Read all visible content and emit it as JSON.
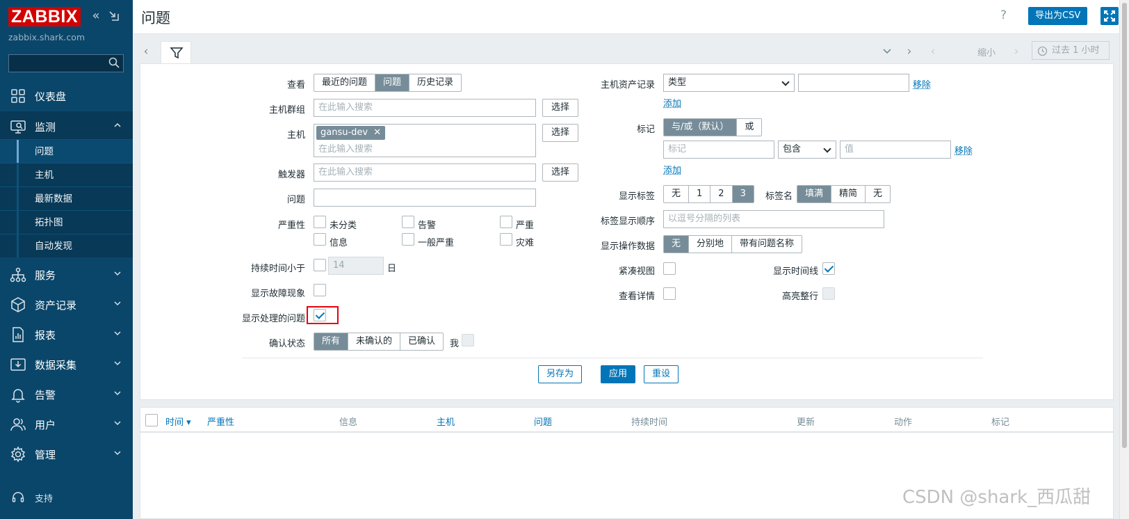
{
  "brand": {
    "logo": "ZABBIX",
    "server": "zabbix.shark.com"
  },
  "sidebar": {
    "nav": [
      {
        "label": "仪表盘",
        "icon": "dashboard-icon"
      },
      {
        "label": "监测",
        "icon": "monitoring-icon",
        "open": true
      },
      {
        "label": "服务",
        "icon": "services-icon"
      },
      {
        "label": "资产记录",
        "icon": "inventory-icon"
      },
      {
        "label": "报表",
        "icon": "reports-icon"
      },
      {
        "label": "数据采集",
        "icon": "data-collection-icon"
      },
      {
        "label": "告警",
        "icon": "alerts-icon"
      },
      {
        "label": "用户",
        "icon": "users-icon"
      },
      {
        "label": "管理",
        "icon": "administration-icon"
      }
    ],
    "monitoring_sub": [
      {
        "label": "问题",
        "active": true
      },
      {
        "label": "主机"
      },
      {
        "label": "最新数据"
      },
      {
        "label": "拓扑图"
      },
      {
        "label": "自动发现"
      }
    ],
    "support": "支持"
  },
  "header": {
    "title": "问题",
    "help": "?",
    "export_csv": "导出为CSV"
  },
  "timebar": {
    "zoom_out": "缩小",
    "time_range": "过去 1 小时"
  },
  "filter": {
    "view_label": "查看",
    "view_options": [
      "最近的问题",
      "问题",
      "历史记录"
    ],
    "view_selected": "问题",
    "hostgroup_label": "主机群组",
    "host_label": "主机",
    "host_chip": "gansu-dev",
    "trigger_label": "触发器",
    "problem_label": "问题",
    "search_placeholder": "在此输入搜索",
    "select_button": "选择",
    "severity_label": "严重性",
    "severities": [
      "未分类",
      "告警",
      "严重",
      "信息",
      "一般严重",
      "灾难"
    ],
    "age_label": "持续时间小于",
    "age_value": "14",
    "age_unit": "日",
    "show_symptoms_label": "显示故障现象",
    "show_suppressed_label": "显示处理的问题",
    "ack_label": "确认状态",
    "ack_options": [
      "所有",
      "未确认的",
      "已确认"
    ],
    "ack_selected": "所有",
    "ack_by_me": "我",
    "inventory_label": "主机资产记录",
    "inventory_field": "类型",
    "remove_link": "移除",
    "add_link": "添加",
    "tags_label": "标记",
    "tags_operator": [
      "与/或（默认）",
      "或"
    ],
    "tag_name_placeholder": "标记",
    "tag_op": "包含",
    "tag_value_placeholder": "值",
    "show_tags_label": "显示标签",
    "show_tags_options": [
      "无",
      "1",
      "2",
      "3"
    ],
    "show_tags_selected": "3",
    "tag_name_label": "标签名",
    "tag_name_options": [
      "填满",
      "精简",
      "无"
    ],
    "tag_name_selected": "填满",
    "tag_priority_label": "标签显示顺序",
    "tag_priority_placeholder": "以逗号分隔的列表",
    "show_opdata_label": "显示操作数据",
    "show_opdata_options": [
      "无",
      "分别地",
      "带有问题名称"
    ],
    "show_opdata_selected": "无",
    "compact_label": "紧凑视图",
    "timeline_label": "显示时间线",
    "details_label": "查看详情",
    "highlight_label": "高亮整行",
    "save_as": "另存为",
    "apply": "应用",
    "reset": "重设"
  },
  "table": {
    "columns": [
      "时间 ▾",
      "严重性",
      "信息",
      "主机",
      "问题",
      "持续时间",
      "更新",
      "动作",
      "标记"
    ]
  },
  "watermark": "CSDN @shark_西瓜甜",
  "colors": {
    "sidebar_bg": "#0a466a",
    "accent": "#0275b8",
    "logo_red": "#d40000",
    "selected_segment": "#768d99",
    "highlight_red": "#e8000a"
  }
}
